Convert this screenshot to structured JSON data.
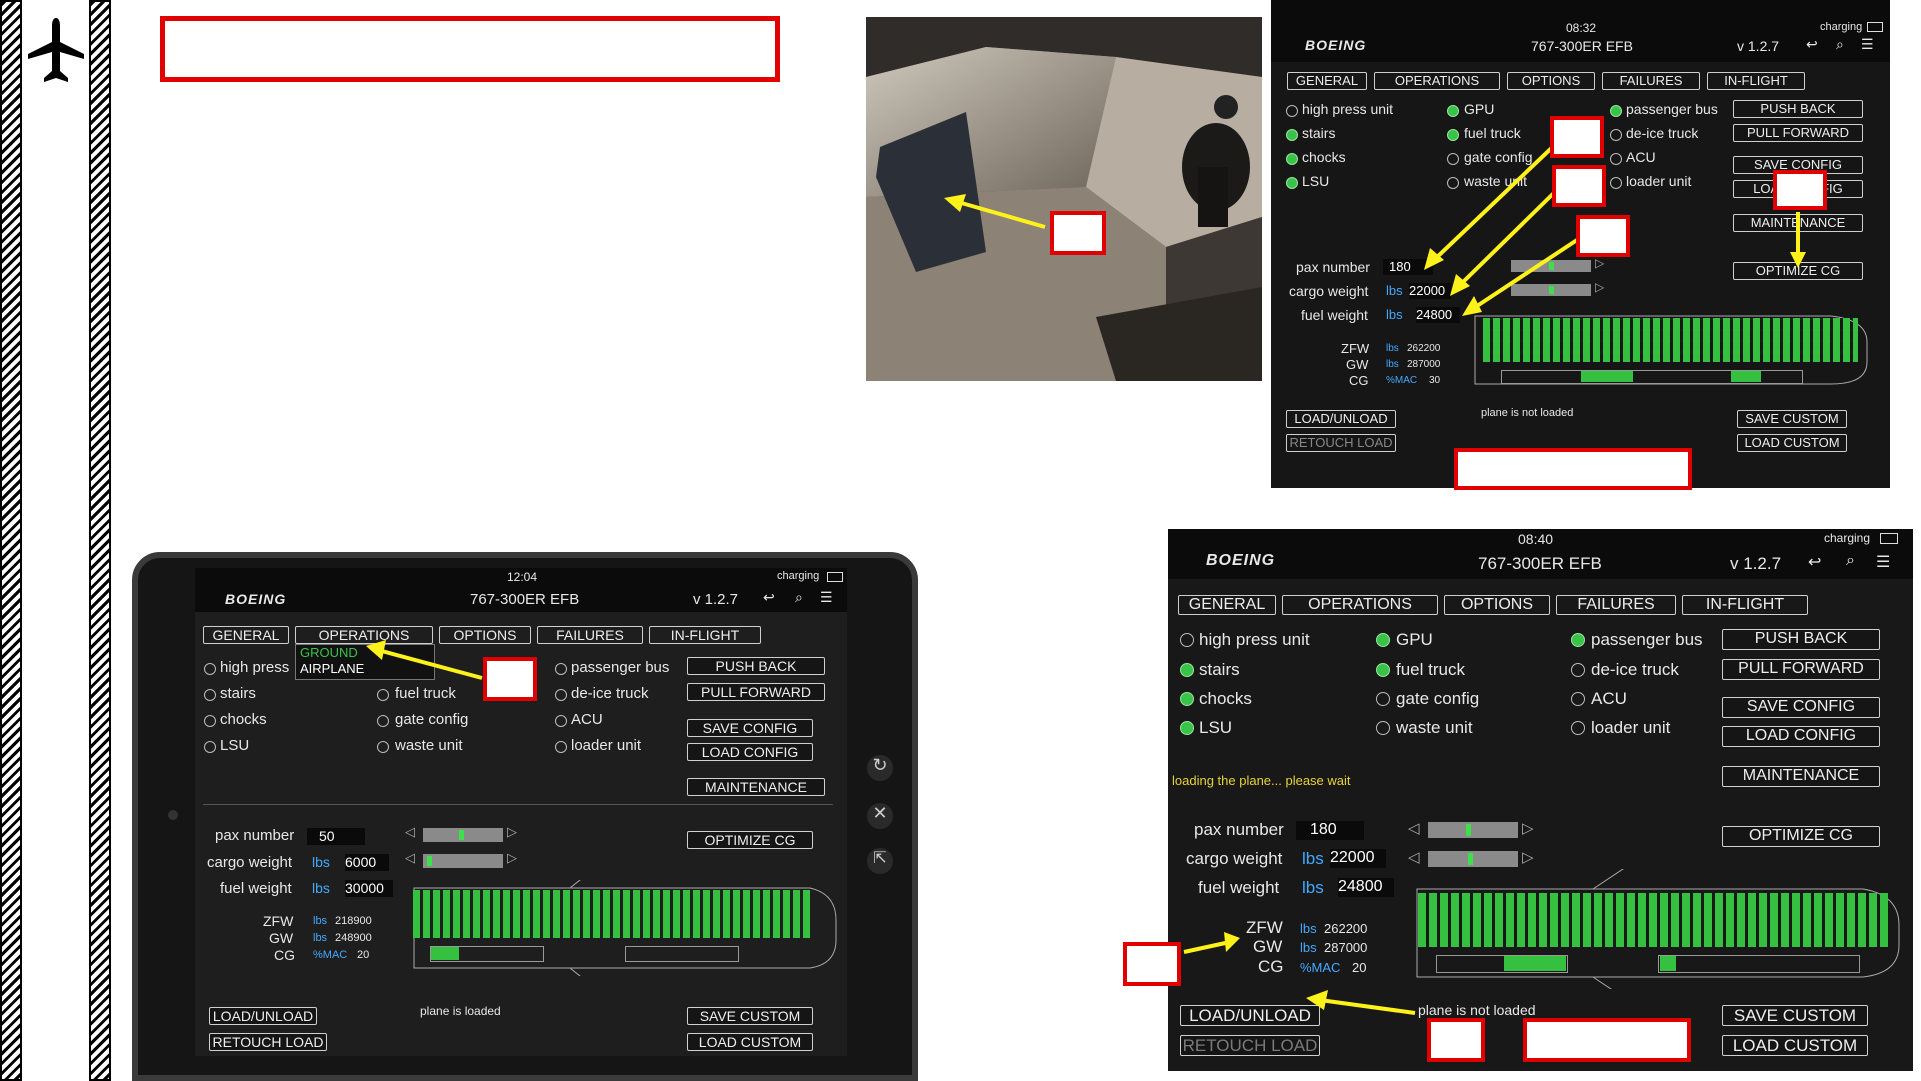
{
  "sidebar": {
    "icon": "airplane-icon"
  },
  "colors": {
    "annotation_red": "#e00000",
    "arrow_yellow": "#fff21a",
    "active_green": "#39c449",
    "unit_blue": "#43a9ff"
  },
  "efb_tl": {
    "time": "08:32",
    "battery": "charging",
    "brand": "BOEING",
    "title": "767-300ER EFB",
    "version": "v 1.2.7",
    "tabs": [
      "GENERAL",
      "OPERATIONS",
      "OPTIONS",
      "FAILURES",
      "IN-FLIGHT"
    ],
    "col1": [
      "high press unit",
      "stairs",
      "chocks",
      "LSU"
    ],
    "col2": [
      "GPU",
      "fuel truck",
      "gate config",
      "waste unit"
    ],
    "col3": [
      "passenger bus",
      "de-ice truck",
      "ACU",
      "loader unit"
    ],
    "right_buttons": [
      "PUSH BACK",
      "PULL FORWARD",
      "SAVE CONFIG",
      "LOAD CONFIG",
      "MAINTENANCE",
      "OPTIMIZE CG"
    ],
    "pax_label": "pax number",
    "pax_value": "180",
    "cargo_label": "cargo weight",
    "cargo_unit": "lbs",
    "cargo_value": "22000",
    "fuel_label": "fuel weight",
    "fuel_unit": "lbs",
    "fuel_value": "24800",
    "zfw_label": "ZFW",
    "zfw_unit": "lbs",
    "zfw_value": "262200",
    "gw_label": "GW",
    "gw_unit": "lbs",
    "gw_value": "287000",
    "cg_label": "CG",
    "cg_unit": "%MAC",
    "cg_value": "30",
    "status": "plane is not loaded",
    "btn_load_unload": "LOAD/UNLOAD",
    "btn_retouch": "RETOUCH LOAD",
    "btn_save_custom": "SAVE CUSTOM",
    "btn_load_custom": "LOAD CUSTOM"
  },
  "efb_bl": {
    "time": "12:04",
    "battery": "charging",
    "brand": "BOEING",
    "title": "767-300ER EFB",
    "version": "v 1.2.7",
    "tabs": [
      "GENERAL",
      "OPERATIONS",
      "OPTIONS",
      "FAILURES",
      "IN-FLIGHT"
    ],
    "dropdown": [
      "GROUND",
      "AIRPLANE"
    ],
    "col1": [
      "high press",
      "stairs",
      "chocks",
      "LSU"
    ],
    "col2": [
      "fuel truck",
      "gate config",
      "waste unit"
    ],
    "col3": [
      "passenger bus",
      "de-ice truck",
      "ACU",
      "loader unit"
    ],
    "right_buttons": [
      "PUSH BACK",
      "PULL FORWARD",
      "SAVE CONFIG",
      "LOAD CONFIG",
      "MAINTENANCE",
      "OPTIMIZE CG"
    ],
    "pax_label": "pax number",
    "pax_value": "50",
    "cargo_label": "cargo weight",
    "cargo_unit": "lbs",
    "cargo_value": "6000",
    "fuel_label": "fuel weight",
    "fuel_unit": "lbs",
    "fuel_value": "30000",
    "zfw_label": "ZFW",
    "zfw_unit": "lbs",
    "zfw_value": "218900",
    "gw_label": "GW",
    "gw_unit": "lbs",
    "gw_value": "248900",
    "cg_label": "CG",
    "cg_unit": "%MAC",
    "cg_value": "20",
    "status": "plane is loaded",
    "btn_load_unload": "LOAD/UNLOAD",
    "btn_retouch": "RETOUCH LOAD",
    "btn_save_custom": "SAVE CUSTOM",
    "btn_load_custom": "LOAD CUSTOM"
  },
  "efb_br": {
    "time": "08:40",
    "battery": "charging",
    "brand": "BOEING",
    "title": "767-300ER EFB",
    "version": "v 1.2.7",
    "tabs": [
      "GENERAL",
      "OPERATIONS",
      "OPTIONS",
      "FAILURES",
      "IN-FLIGHT"
    ],
    "col1": [
      "high press unit",
      "stairs",
      "chocks",
      "LSU"
    ],
    "col2": [
      "GPU",
      "fuel truck",
      "gate config",
      "waste unit"
    ],
    "col3": [
      "passenger bus",
      "de-ice truck",
      "ACU",
      "loader unit"
    ],
    "right_buttons": [
      "PUSH BACK",
      "PULL FORWARD",
      "SAVE CONFIG",
      "LOAD CONFIG",
      "MAINTENANCE",
      "OPTIMIZE CG"
    ],
    "loading_msg": "loading the plane... please wait",
    "pax_label": "pax number",
    "pax_value": "180",
    "cargo_label": "cargo weight",
    "cargo_unit": "lbs",
    "cargo_value": "22000",
    "fuel_label": "fuel weight",
    "fuel_unit": "lbs",
    "fuel_value": "24800",
    "zfw_label": "ZFW",
    "zfw_unit": "lbs",
    "zfw_value": "262200",
    "gw_label": "GW",
    "gw_unit": "lbs",
    "gw_value": "287000",
    "cg_label": "CG",
    "cg_unit": "%MAC",
    "cg_value": "20",
    "status": "plane is not loaded",
    "btn_load_unload": "LOAD/UNLOAD",
    "btn_retouch": "RETOUCH LOAD",
    "btn_save_custom": "SAVE CUSTOM",
    "btn_load_custom": "LOAD CUSTOM"
  }
}
